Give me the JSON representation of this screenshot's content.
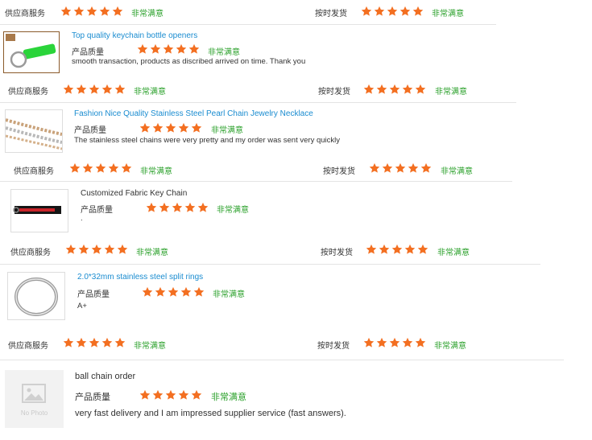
{
  "rating_labels": {
    "supplier_service": "供应商服务",
    "on_time_delivery": "按时发货",
    "product_quality": "产品质量",
    "very_satisfied": "非常满意"
  },
  "colors": {
    "star": "#f36f21",
    "link": "#1a8cd0",
    "satisfied": "#2aa02a"
  },
  "star_rating": 5,
  "reviews": [
    {
      "title": "Top quality keychain bottle openers",
      "comment": "smooth transaction, products as discribed arrived on time. Thank you"
    },
    {
      "title": "Fashion Nice Quality Stainless Steel Pearl Chain Jewelry Necklace",
      "comment": "The stainless steel chains were very pretty and my order was sent very quickly"
    },
    {
      "title": "Customized Fabric Key Chain",
      "comment": "."
    },
    {
      "title": "2.0*32mm stainless steel split rings",
      "comment": "A+"
    },
    {
      "title": "ball chain order",
      "comment": "very fast delivery and I am impressed supplier service (fast answers).",
      "thumb_text": "No Photo"
    }
  ]
}
